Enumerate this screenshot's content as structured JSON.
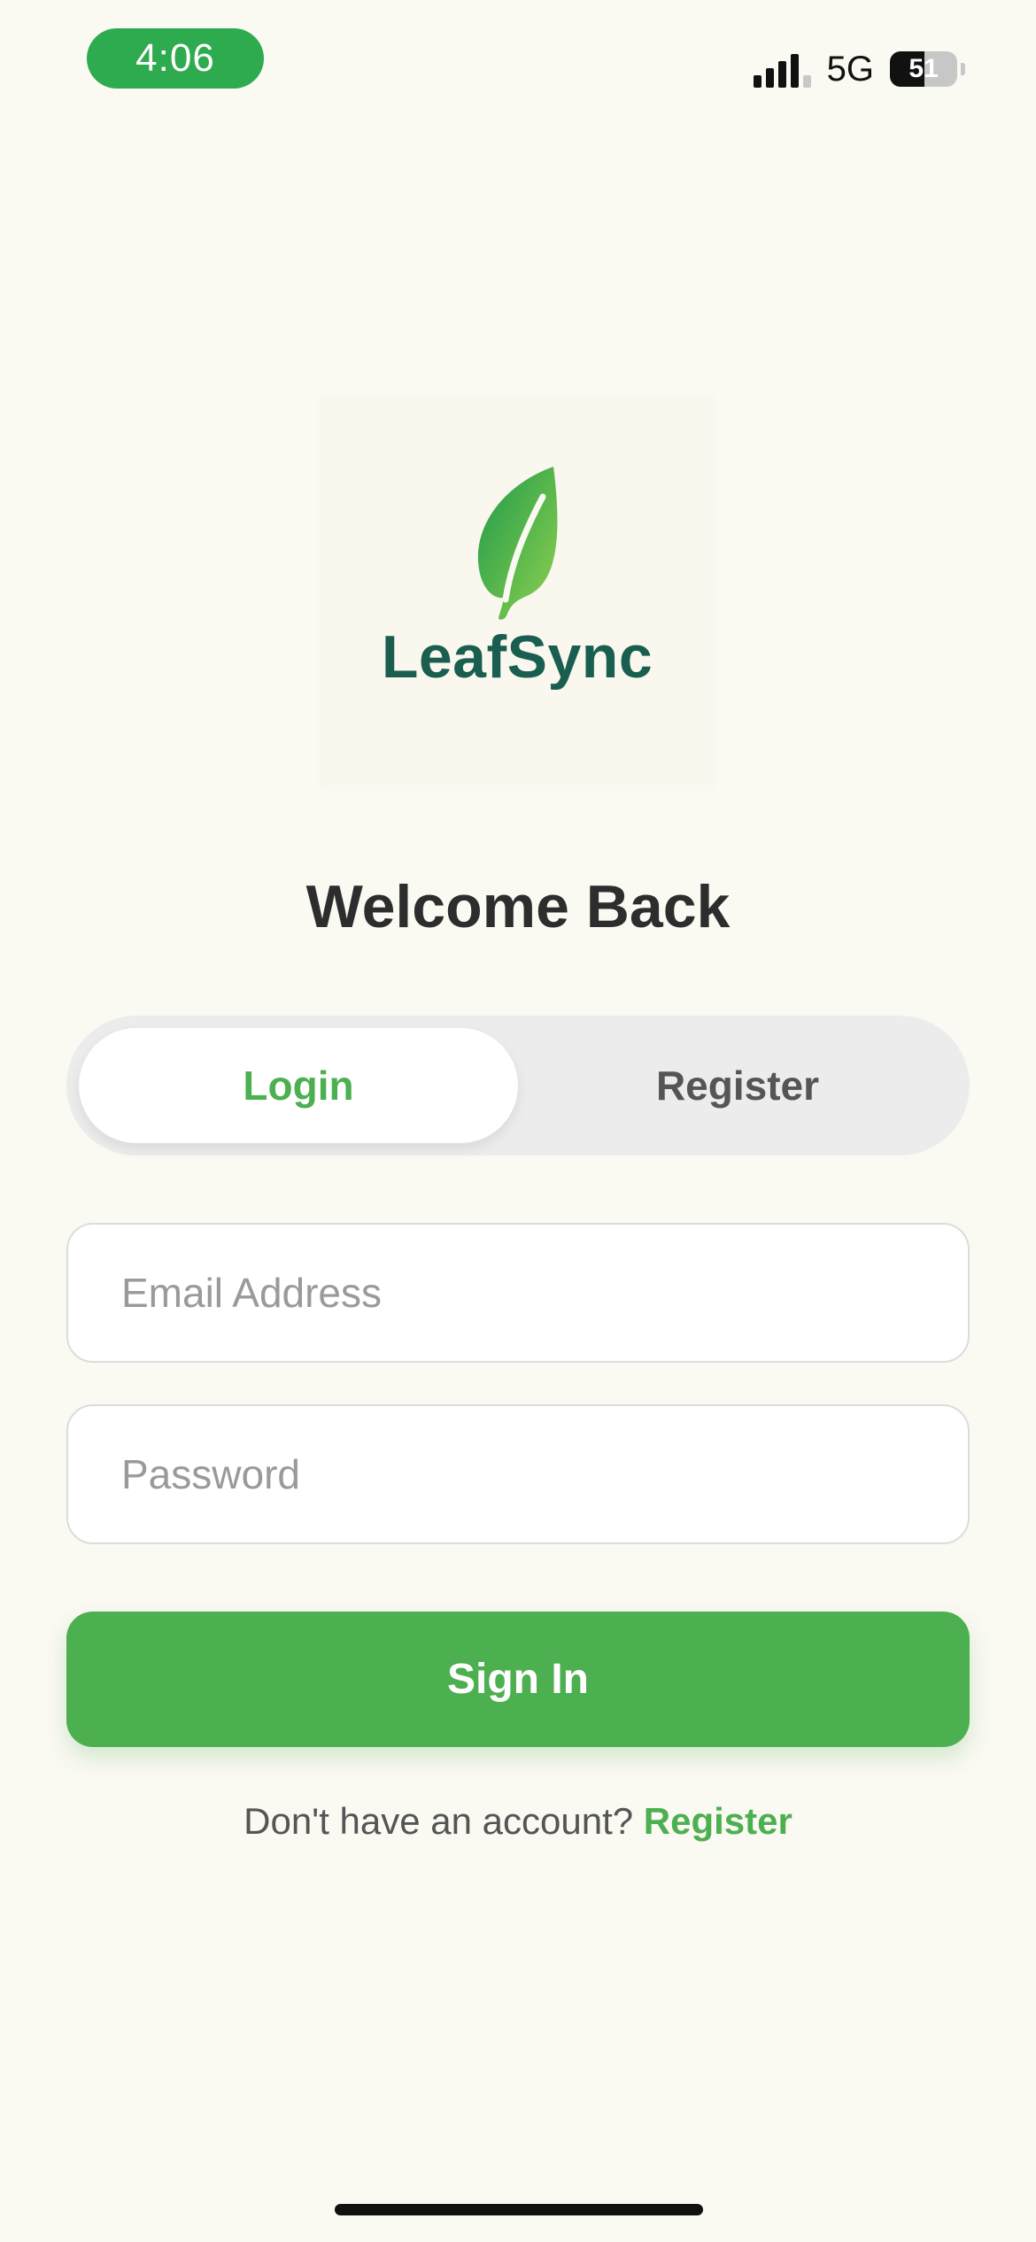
{
  "status_bar": {
    "time": "4:06",
    "network": "5G",
    "battery": "51",
    "battery_level": 0.51,
    "signal_bars": 4
  },
  "brand": {
    "name": "LeafSync",
    "icon": "leaf-icon",
    "colors": {
      "leaf_dark": "#1e9a4a",
      "leaf_light": "#8fd14f",
      "text": "#1a5e50"
    }
  },
  "page": {
    "title": "Welcome Back"
  },
  "tabs": [
    {
      "label": "Login",
      "active": true
    },
    {
      "label": "Register",
      "active": false
    }
  ],
  "form": {
    "email": {
      "placeholder": "Email Address",
      "value": ""
    },
    "password": {
      "placeholder": "Password",
      "value": ""
    },
    "submit_label": "Sign In"
  },
  "footer": {
    "prompt": "Don't have an account?",
    "link": "Register"
  },
  "colors": {
    "accent": "#4caf50",
    "background": "#faf9f2",
    "status_pill": "#2eaa4f"
  }
}
